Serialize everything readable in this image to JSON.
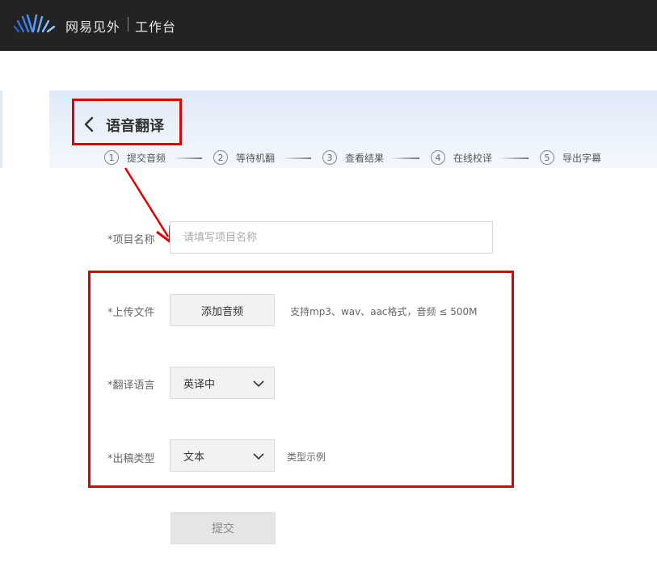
{
  "header": {
    "brand": "网易见外",
    "workbench": "工作台",
    "logo_icon": "waveform-logo-icon",
    "bg_color": "#232323"
  },
  "page": {
    "title": "语音翻译",
    "back_icon": "chevron-left-icon"
  },
  "steps": [
    {
      "num": "1",
      "label": "提交音频"
    },
    {
      "num": "2",
      "label": "等待机翻"
    },
    {
      "num": "3",
      "label": "查看结果"
    },
    {
      "num": "4",
      "label": "在线校译"
    },
    {
      "num": "5",
      "label": "导出字幕"
    }
  ],
  "form": {
    "project_name": {
      "label": "*项目名称",
      "placeholder": "请填写项目名称",
      "value": ""
    },
    "upload": {
      "label": "*上传文件",
      "button": "添加音频",
      "hint": "支持mp3、wav、aac格式，音频 ≤ 500M"
    },
    "language": {
      "label": "*翻译语言",
      "selected": "英译中"
    },
    "output_type": {
      "label": "*出稿类型",
      "selected": "文本",
      "hint": "类型示例"
    },
    "submit": "提交"
  },
  "annotations": {
    "highlight_color": "#e00000"
  }
}
